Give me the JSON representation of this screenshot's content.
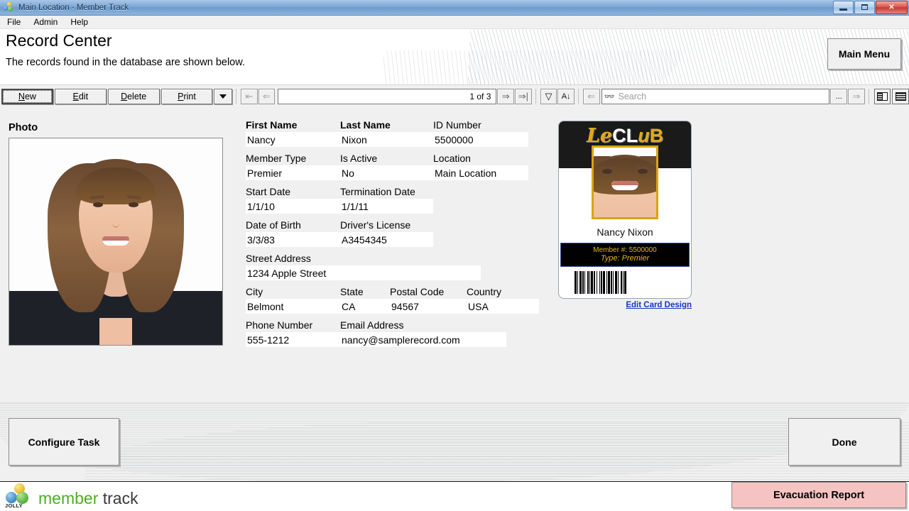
{
  "window": {
    "title": "Main Location - Member Track",
    "icon": "jolly-balls-icon",
    "controls": {
      "minimize": "minimize-button",
      "maximize": "maximize-button",
      "close": "✕"
    }
  },
  "menu": {
    "items": [
      "File",
      "Admin",
      "Help"
    ]
  },
  "header": {
    "title": "Record Center",
    "subtitle": "The records found in the database are shown below.",
    "main_menu_label": "Main Menu"
  },
  "toolbar": {
    "buttons": [
      {
        "label": "New",
        "accesskey": "N",
        "focused": true
      },
      {
        "label": "Edit",
        "accesskey": "E",
        "focused": false
      },
      {
        "label": "Delete",
        "accesskey": "D",
        "focused": false
      },
      {
        "label": "Print",
        "accesskey": "P",
        "focused": false
      }
    ],
    "dropdown": "caret-down-icon",
    "nav_first": "⇤",
    "nav_prev": "⇐",
    "record_position": "1 of 3",
    "nav_next": "⇒",
    "nav_last": "⇒|",
    "filter": "▽",
    "sort": "A↓",
    "back": "⇐",
    "search_icon": "binoculars-icon",
    "search_value": "",
    "search_placeholder": "Search",
    "ellipsis": "...",
    "go": "⇒",
    "view_detail": "detail-view-icon",
    "view_list": "list-view-icon"
  },
  "record": {
    "photo_label": "Photo",
    "fields": [
      {
        "cells": [
          {
            "label": "First Name",
            "value": "Nancy",
            "bold": true,
            "lw": 133,
            "vw": 133
          },
          {
            "label": "Last Name",
            "value": "Nixon",
            "bold": true,
            "lw": 131,
            "vw": 131
          },
          {
            "label": "ID Number",
            "value": "5500000",
            "bold": false,
            "lw": 134,
            "vw": 134
          }
        ]
      },
      {
        "cells": [
          {
            "label": "Member Type",
            "value": "Premier",
            "bold": false,
            "lw": 133,
            "vw": 133
          },
          {
            "label": "Is Active",
            "value": "No",
            "bold": false,
            "lw": 131,
            "vw": 131
          },
          {
            "label": "Location",
            "value": "Main Location",
            "bold": false,
            "lw": 134,
            "vw": 134
          }
        ]
      },
      {
        "cells": [
          {
            "label": "Start Date",
            "value": "1/1/10",
            "bold": false,
            "lw": 133,
            "vw": 133
          },
          {
            "label": "Termination Date",
            "value": "1/1/11",
            "bold": false,
            "lw": 131,
            "vw": 131
          }
        ]
      },
      {
        "cells": [
          {
            "label": "Date of Birth",
            "value": "3/3/83",
            "bold": false,
            "lw": 133,
            "vw": 133
          },
          {
            "label": "Driver's License",
            "value": "A3454345",
            "bold": false,
            "lw": 131,
            "vw": 131
          }
        ]
      },
      {
        "cells": [
          {
            "label": "Street Address",
            "value": "1234 Apple Street",
            "bold": false,
            "lw": 331,
            "vw": 331
          }
        ]
      },
      {
        "cells": [
          {
            "label": "City",
            "value": "Belmont",
            "bold": false,
            "lw": 133,
            "vw": 133
          },
          {
            "label": "State",
            "value": "CA",
            "bold": false,
            "lw": 70,
            "vw": 70
          },
          {
            "label": "Postal Code",
            "value": "94567",
            "bold": false,
            "lw": 108,
            "vw": 108
          },
          {
            "label": "Country",
            "value": "USA",
            "bold": false,
            "lw": 102,
            "vw": 102
          }
        ]
      },
      {
        "cells": [
          {
            "label": "Phone Number",
            "value": "555-1212",
            "bold": false,
            "lw": 133,
            "vw": 133
          },
          {
            "label": "Email Address",
            "value": "nancy@samplerecord.com",
            "bold": false,
            "lw": 234,
            "vw": 234
          }
        ]
      }
    ]
  },
  "card": {
    "logo": {
      "le": "Le",
      "cl": "CL",
      "u": "u",
      "b": "B"
    },
    "name": "Nancy Nixon",
    "member_line": "Member #: 5500000",
    "type_line": "Type: Premier",
    "barcode": "barcode-icon",
    "edit_link": "Edit Card Design",
    "colors": {
      "gold": "#e0a81c",
      "band_bg": "#000000",
      "band_border": "#33539e"
    }
  },
  "footer": {
    "configure_label": "Configure Task",
    "done_label": "Done"
  },
  "status": {
    "brand_mark": "jolly-logo-icon",
    "brand_mark_text": "JOLLY",
    "brand_word1": "member",
    "brand_word2": "track",
    "evacuation_label": "Evacuation Report",
    "colors": {
      "member_green": "#4caf1f",
      "track_gray": "#3a3a3a",
      "evac_pink": "#f6c3c3"
    }
  }
}
